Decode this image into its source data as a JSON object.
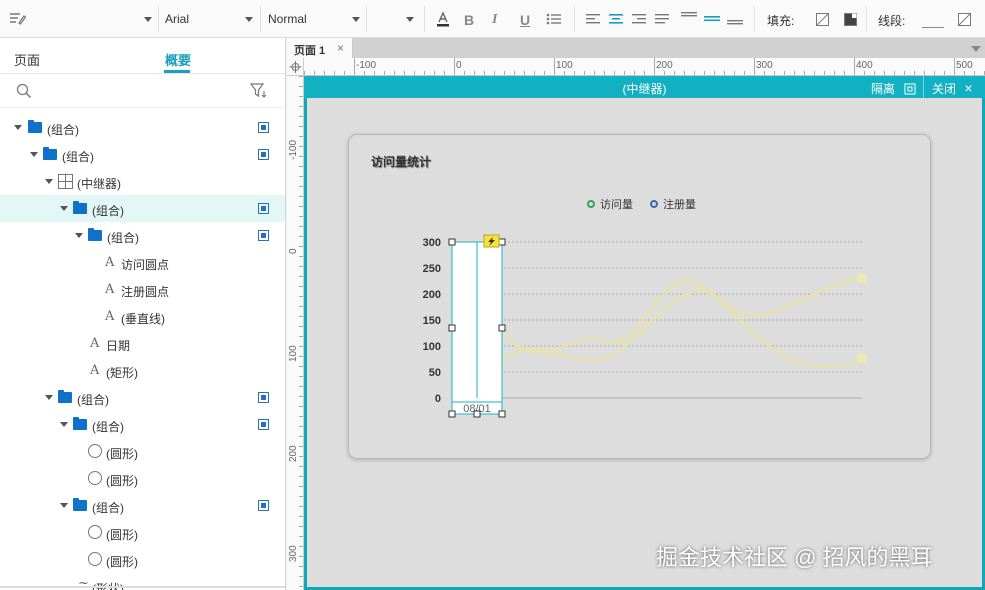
{
  "toolbar": {
    "font_family": "Arial",
    "font_style": "Normal",
    "fill_label": "填充:",
    "stroke_label": "线段:"
  },
  "left_panel": {
    "tabs": [
      {
        "label": "页面"
      },
      {
        "label": "概要"
      }
    ],
    "tree": [
      {
        "label": "(组合)",
        "icon": "folder-icon"
      },
      {
        "label": "(组合)",
        "icon": "folder-icon"
      },
      {
        "label": "(中继器)",
        "icon": "repeater-icon"
      },
      {
        "label": "(组合)",
        "icon": "folder-icon"
      },
      {
        "label": "(组合)",
        "icon": "folder-icon"
      },
      {
        "label": "访问圆点",
        "icon": "text-icon"
      },
      {
        "label": "注册圆点",
        "icon": "text-icon"
      },
      {
        "label": "(垂直线)",
        "icon": "text-icon"
      },
      {
        "label": "日期",
        "icon": "text-icon"
      },
      {
        "label": "(矩形)",
        "icon": "text-icon"
      },
      {
        "label": "(组合)",
        "icon": "folder-icon"
      },
      {
        "label": "(组合)",
        "icon": "folder-icon"
      },
      {
        "label": "(圆形)",
        "icon": "circle-icon"
      },
      {
        "label": "(圆形)",
        "icon": "circle-icon"
      },
      {
        "label": "(组合)",
        "icon": "folder-icon"
      },
      {
        "label": "(圆形)",
        "icon": "circle-icon"
      },
      {
        "label": "(圆形)",
        "icon": "circle-icon"
      },
      {
        "label": "(形状)",
        "icon": "shape-icon"
      }
    ]
  },
  "page_tab": {
    "label": "页面 1"
  },
  "rulers": {
    "top": [
      "-100",
      "0",
      "100",
      "200",
      "300",
      "400",
      "500"
    ],
    "left": [
      "-100",
      "0",
      "100",
      "200",
      "300"
    ]
  },
  "overlay": {
    "title": "(中继器)",
    "isolate_label": "隔离",
    "close_label": "关闭"
  },
  "chart_data": {
    "type": "line",
    "title": "访问量统计",
    "categories": [
      "08/01"
    ],
    "series": [
      {
        "name": "访问量",
        "color": "#3a9e5c"
      },
      {
        "name": "注册量",
        "color": "#3a6ea0"
      }
    ],
    "yticks": [
      "300",
      "250",
      "200",
      "150",
      "100",
      "50",
      "0"
    ],
    "ylim": [
      0,
      300
    ],
    "grid": true
  },
  "watermark": "掘金技术社区 @ 招风的黑耳",
  "colors": {
    "accent": "#12b0c0",
    "folder": "#0d72c8"
  }
}
